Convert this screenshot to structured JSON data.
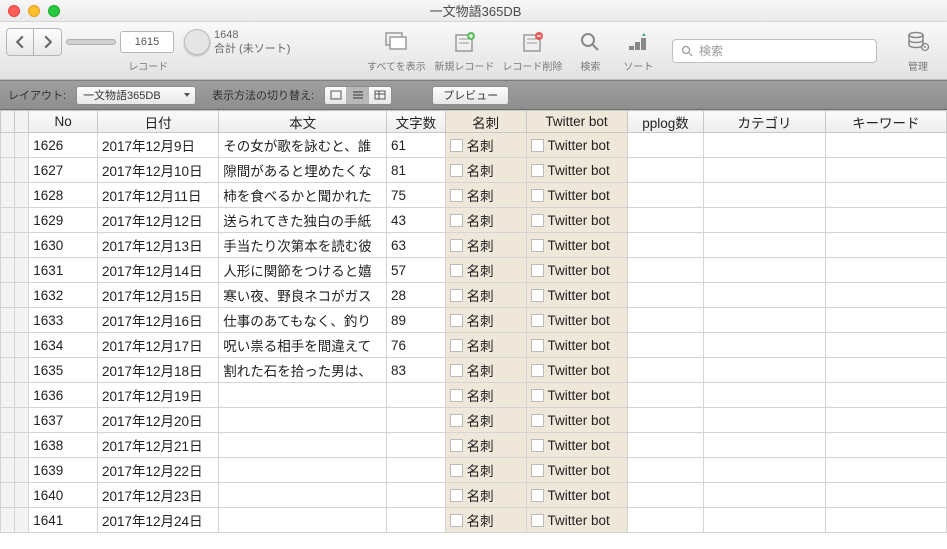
{
  "window": {
    "title": "一文物語365DB"
  },
  "toolbar": {
    "current_record": "1615",
    "total_records": "1648",
    "total_label": "合計 (未ソート)",
    "record_label": "レコード",
    "show_all": "すべてを表示",
    "new_record": "新規レコード",
    "delete_record": "レコード削除",
    "search": "検索",
    "sort": "ソート",
    "search_placeholder": "検索",
    "admin": "管理"
  },
  "layoutbar": {
    "layout_label": "レイアウト:",
    "layout_value": "一文物語365DB",
    "view_label": "表示方法の切り替え:",
    "preview": "プレビュー"
  },
  "columns": {
    "no": "No",
    "date": "日付",
    "body": "本文",
    "charcount": "文字数",
    "meishi": "名刺",
    "twitter": "Twitter bot",
    "pplog": "pplog数",
    "category": "カテゴリ",
    "keyword": "キーワード"
  },
  "rows": [
    {
      "no": "1626",
      "date": "2017年12月9日",
      "body": "その女が歌を詠むと、誰",
      "cc": "61",
      "meishi": "名刺",
      "tw": "Twitter bot"
    },
    {
      "no": "1627",
      "date": "2017年12月10日",
      "body": "隙間があると埋めたくな",
      "cc": "81",
      "meishi": "名刺",
      "tw": "Twitter bot"
    },
    {
      "no": "1628",
      "date": "2017年12月11日",
      "body": "柿を食べるかと聞かれた",
      "cc": "75",
      "meishi": "名刺",
      "tw": "Twitter bot"
    },
    {
      "no": "1629",
      "date": "2017年12月12日",
      "body": "送られてきた独白の手紙",
      "cc": "43",
      "meishi": "名刺",
      "tw": "Twitter bot"
    },
    {
      "no": "1630",
      "date": "2017年12月13日",
      "body": "手当たり次第本を読む彼",
      "cc": "63",
      "meishi": "名刺",
      "tw": "Twitter bot"
    },
    {
      "no": "1631",
      "date": "2017年12月14日",
      "body": "人形に関節をつけると嬉",
      "cc": "57",
      "meishi": "名刺",
      "tw": "Twitter bot"
    },
    {
      "no": "1632",
      "date": "2017年12月15日",
      "body": "寒い夜、野良ネコがガス",
      "cc": "28",
      "meishi": "名刺",
      "tw": "Twitter bot"
    },
    {
      "no": "1633",
      "date": "2017年12月16日",
      "body": "仕事のあてもなく、釣り",
      "cc": "89",
      "meishi": "名刺",
      "tw": "Twitter bot"
    },
    {
      "no": "1634",
      "date": "2017年12月17日",
      "body": "呪い祟る相手を間違えて",
      "cc": "76",
      "meishi": "名刺",
      "tw": "Twitter bot"
    },
    {
      "no": "1635",
      "date": "2017年12月18日",
      "body": "割れた石を拾った男は、",
      "cc": "83",
      "meishi": "名刺",
      "tw": "Twitter bot"
    },
    {
      "no": "1636",
      "date": "2017年12月19日",
      "body": "",
      "cc": "",
      "meishi": "名刺",
      "tw": "Twitter bot"
    },
    {
      "no": "1637",
      "date": "2017年12月20日",
      "body": "",
      "cc": "",
      "meishi": "名刺",
      "tw": "Twitter bot"
    },
    {
      "no": "1638",
      "date": "2017年12月21日",
      "body": "",
      "cc": "",
      "meishi": "名刺",
      "tw": "Twitter bot"
    },
    {
      "no": "1639",
      "date": "2017年12月22日",
      "body": "",
      "cc": "",
      "meishi": "名刺",
      "tw": "Twitter bot"
    },
    {
      "no": "1640",
      "date": "2017年12月23日",
      "body": "",
      "cc": "",
      "meishi": "名刺",
      "tw": "Twitter bot"
    },
    {
      "no": "1641",
      "date": "2017年12月24日",
      "body": "",
      "cc": "",
      "meishi": "名刺",
      "tw": "Twitter bot"
    }
  ]
}
